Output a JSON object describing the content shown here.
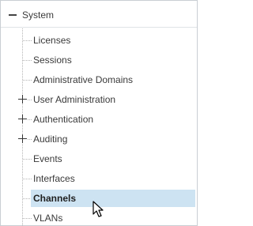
{
  "tree": {
    "root": {
      "label": "System",
      "expanded": true,
      "expander_icon": "minus-icon"
    },
    "children": [
      {
        "label": "Licenses",
        "expandable": false
      },
      {
        "label": "Sessions",
        "expandable": false
      },
      {
        "label": "Administrative Domains",
        "expandable": false
      },
      {
        "label": "User Administration",
        "expandable": true,
        "expander_icon": "plus-icon"
      },
      {
        "label": "Authentication",
        "expandable": true,
        "expander_icon": "plus-icon"
      },
      {
        "label": "Auditing",
        "expandable": true,
        "expander_icon": "plus-icon"
      },
      {
        "label": "Events",
        "expandable": false
      },
      {
        "label": "Interfaces",
        "expandable": false
      },
      {
        "label": "Channels",
        "expandable": false,
        "selected": true
      },
      {
        "label": "VLANs",
        "expandable": false
      }
    ]
  },
  "colors": {
    "selection_background": "#cde3f2",
    "text": "#3a3a3a",
    "tree_lines": "#b5b5b5"
  },
  "cursor": {
    "icon": "mouse-pointer-icon"
  }
}
